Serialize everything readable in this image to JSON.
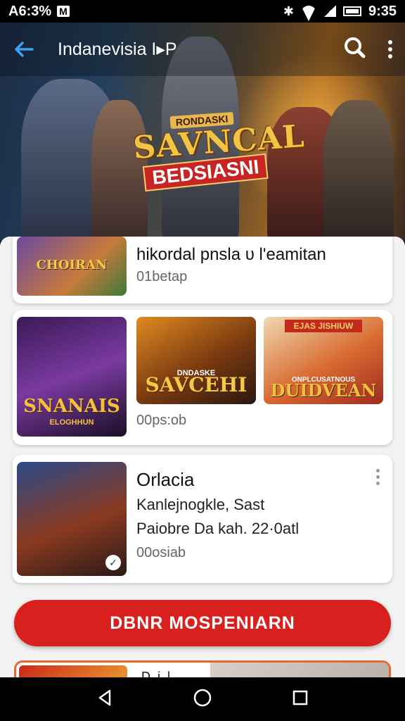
{
  "status_bar": {
    "time_left": "A6:3%",
    "notif_letter": "M",
    "time_right": "9:35"
  },
  "app_bar": {
    "title": "Indanevisia I▸P",
    "icons": [
      "back-arrow-icon",
      "search-icon",
      "more-vert-icon"
    ]
  },
  "hero": {
    "logo_top": "RONDASKI",
    "logo_main": "SAVNCAL",
    "logo_sub": "BEDSIASNI"
  },
  "cards": [
    {
      "thumb_label": "CHOIRAN",
      "title": "hikordal рnsla υ l'eamitan",
      "meta": "01betap"
    },
    {
      "thumbs": [
        {
          "label": "SNANAIS",
          "sub": "ELOGHHUN"
        },
        {
          "label": "SAVCEHI",
          "sub": "DNDASKE"
        },
        {
          "label": "DUIDVEAN",
          "banner": "EJAS JISHIUW",
          "sub": "ONPLCUSATNOUS"
        }
      ],
      "meta": "00ps:ob"
    },
    {
      "title": "Orlacia",
      "line1": "Kanlejnogkle, Sast",
      "line2": "Paiobre Da kah. 22·0atl",
      "meta": "00osiab"
    }
  ],
  "cta": {
    "label": "DBNR MOSPENIARN"
  },
  "peek_card": {
    "title": "D..j..l"
  }
}
